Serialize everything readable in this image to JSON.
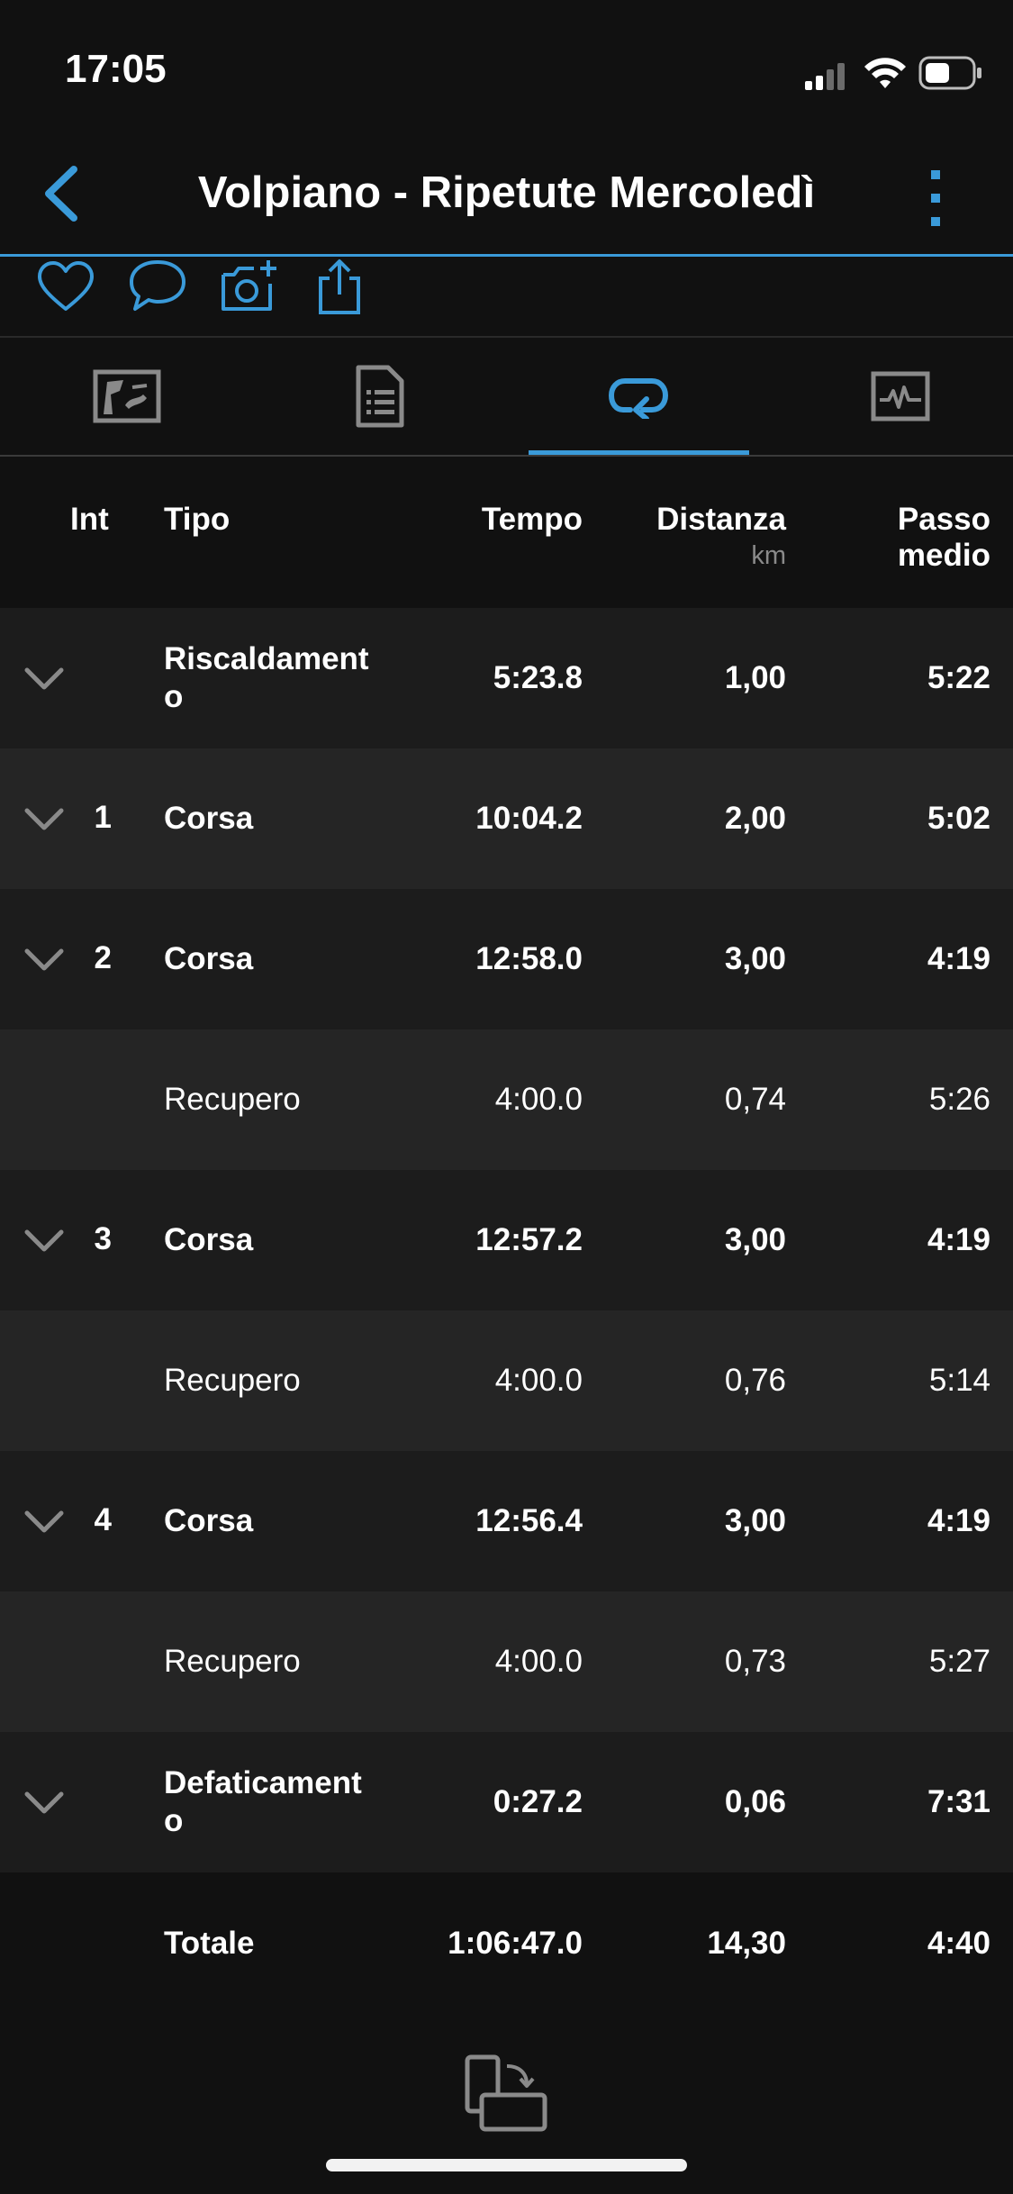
{
  "status_bar": {
    "time": "17:05"
  },
  "header": {
    "title": "Volpiano - Ripetute Mercoledì"
  },
  "table": {
    "columns": {
      "int": "Int",
      "tipo": "Tipo",
      "tempo": "Tempo",
      "distanza": "Distanza",
      "distanza_unit": "km",
      "passo": "Passo",
      "passo2": "medio"
    },
    "rows": [
      {
        "int": "",
        "tipo": "Riscaldament",
        "tipo2": "o",
        "tempo": "5:23.8",
        "distanza": "1,00",
        "passo": "5:22"
      },
      {
        "int": "1",
        "tipo": "Corsa",
        "tempo": "10:04.2",
        "distanza": "2,00",
        "passo": "5:02"
      },
      {
        "int": "2",
        "tipo": "Corsa",
        "tempo": "12:58.0",
        "distanza": "3,00",
        "passo": "4:19"
      },
      {
        "int": "",
        "tipo": "Recupero",
        "tempo": "4:00.0",
        "distanza": "0,74",
        "passo": "5:26"
      },
      {
        "int": "3",
        "tipo": "Corsa",
        "tempo": "12:57.2",
        "distanza": "3,00",
        "passo": "4:19"
      },
      {
        "int": "",
        "tipo": "Recupero",
        "tempo": "4:00.0",
        "distanza": "0,76",
        "passo": "5:14"
      },
      {
        "int": "4",
        "tipo": "Corsa",
        "tempo": "12:56.4",
        "distanza": "3,00",
        "passo": "4:19"
      },
      {
        "int": "",
        "tipo": "Recupero",
        "tempo": "4:00.0",
        "distanza": "0,73",
        "passo": "5:27"
      },
      {
        "int": "",
        "tipo": "Defaticament",
        "tipo2": "o",
        "tempo": "0:27.2",
        "distanza": "0,06",
        "passo": "7:31"
      }
    ],
    "total": {
      "label": "Totale",
      "tempo": "1:06:47.0",
      "distanza": "14,30",
      "passo": "4:40"
    }
  },
  "colors": {
    "accent": "#3a9ad9",
    "background": "#111111",
    "row_dark": "#1c1c1c",
    "row_light": "#252525"
  },
  "icons": [
    "back-chevron-icon",
    "more-vertical-icon",
    "heart-icon",
    "comment-icon",
    "add-photo-icon",
    "share-icon",
    "map-tab-icon",
    "details-tab-icon",
    "laps-tab-icon",
    "chart-tab-icon",
    "expand-chevron-icon",
    "rotate-device-icon"
  ]
}
